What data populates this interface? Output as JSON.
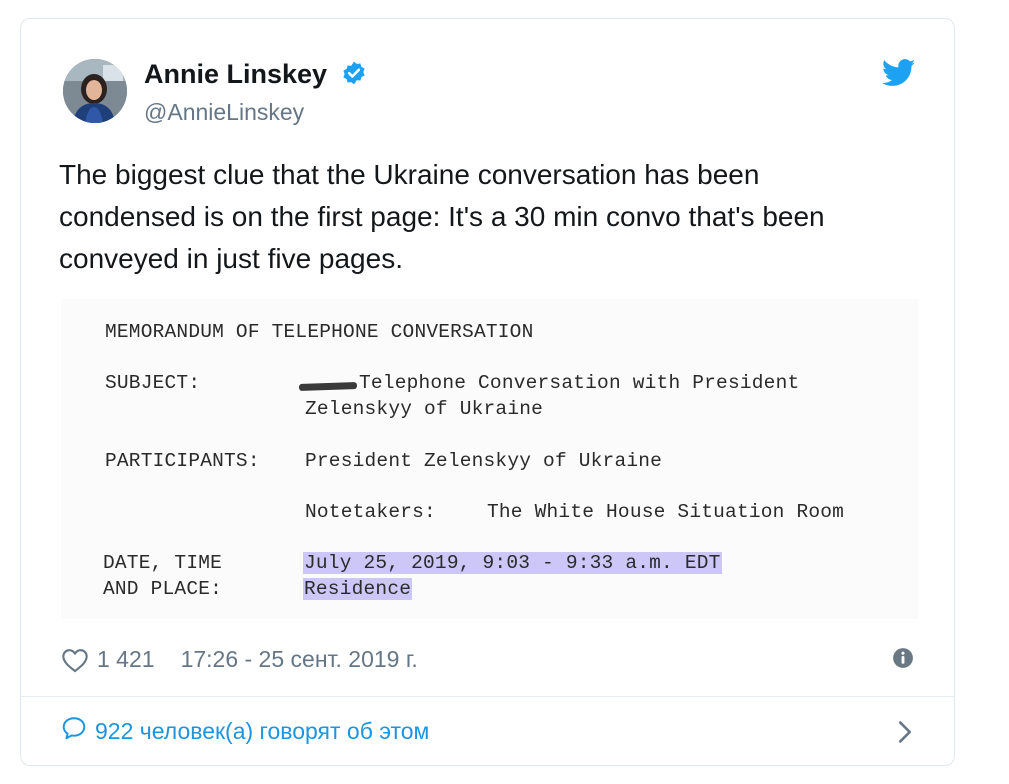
{
  "author": {
    "display_name": "Annie Linskey",
    "handle": "@AnnieLinskey",
    "verified": true,
    "avatar_icon": "profile-photo",
    "platform_icon": "twitter-bird-icon"
  },
  "tweet": {
    "text": "The biggest clue that the Ukraine conversation has been\ncondensed is on the first page: It's a 30 min convo that's been\nconveyed in just five pages."
  },
  "document": {
    "title": "MEMORANDUM OF TELEPHONE CONVERSATION",
    "subject_label": "SUBJECT:",
    "subject_line1": "Telephone Conversation with President",
    "subject_line2": "Zelenskyy of Ukraine",
    "participants_label": "PARTICIPANTS:",
    "participants_value": "President Zelenskyy of Ukraine",
    "notetakers_label": "Notetakers:",
    "notetakers_value": "The White House Situation Room",
    "date_label_line1": "DATE, TIME",
    "date_label_line2": "AND PLACE:",
    "date_value_line1": "July 25, 2019, 9:03 - 9:33 a.m. EDT",
    "date_value_line2": "Residence",
    "highlight_color": "#cdc7f7"
  },
  "footer": {
    "like_count": "1 421",
    "timestamp": "17:26 - 25 сент. 2019 г.",
    "conversation_label": "922 человек(а) говорят об этом"
  },
  "colors": {
    "accent": "#1da1f2",
    "link": "#1b95e0",
    "text": "#14171a",
    "muted": "#657786"
  }
}
